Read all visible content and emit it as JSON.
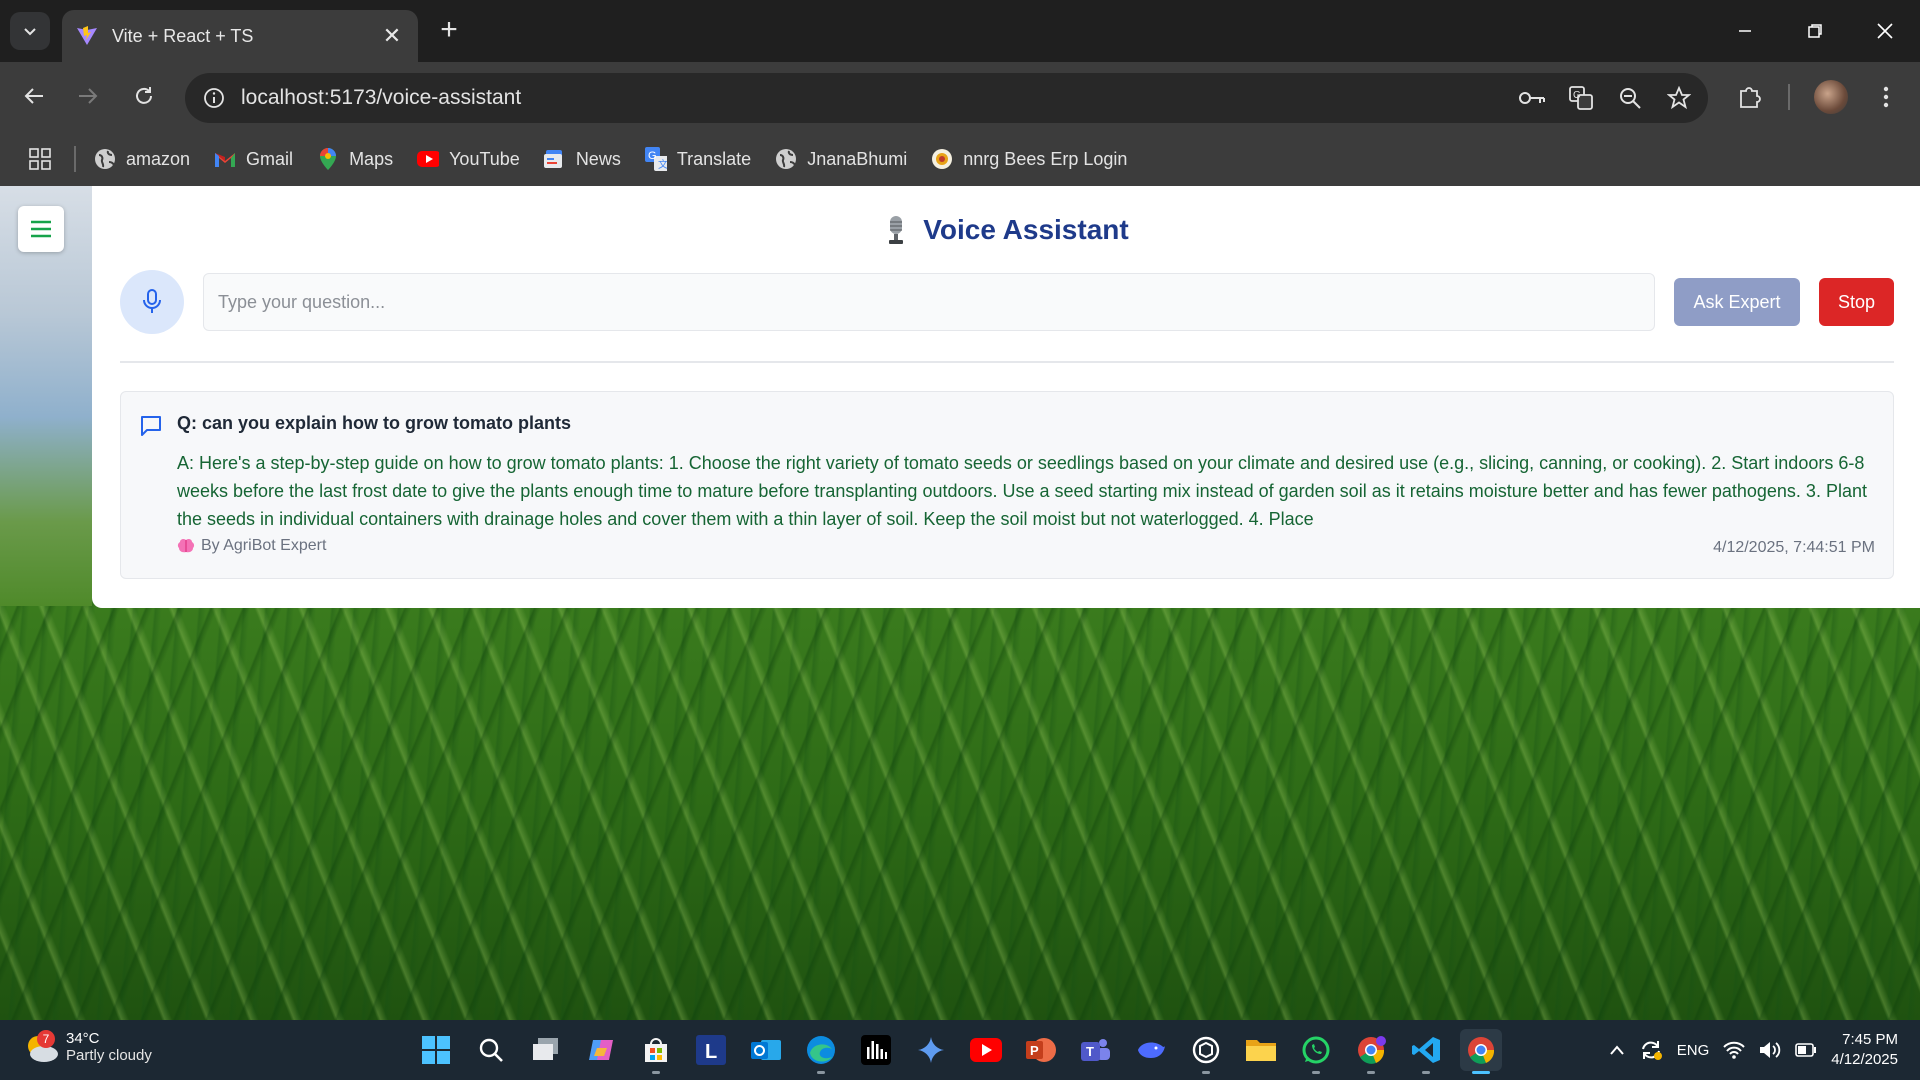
{
  "browser": {
    "tab_title": "Vite + React + TS",
    "url": "localhost:5173/voice-assistant",
    "bookmarks": [
      {
        "label": "amazon",
        "icon": "globe-icon"
      },
      {
        "label": "Gmail",
        "icon": "gmail-icon"
      },
      {
        "label": "Maps",
        "icon": "maps-icon"
      },
      {
        "label": "YouTube",
        "icon": "youtube-icon"
      },
      {
        "label": "News",
        "icon": "news-icon"
      },
      {
        "label": "Translate",
        "icon": "translate-icon"
      },
      {
        "label": "JnanaBhumi",
        "icon": "globe-icon"
      },
      {
        "label": "nnrg Bees Erp Login",
        "icon": "nnrg-icon"
      }
    ]
  },
  "page": {
    "title": "Voice Assistant",
    "input_placeholder": "Type your question...",
    "ask_button": "Ask Expert",
    "stop_button": "Stop",
    "entries": [
      {
        "question": "Q: can you explain how to grow tomato plants",
        "answer": "A: Here's a step-by-step guide on how to grow tomato plants: 1. Choose the right variety of tomato seeds or seedlings based on your climate and desired use (e.g., slicing, canning, or cooking). 2. Start indoors 6-8 weeks before the last frost date to give the plants enough time to mature before transplanting outdoors. Use a seed starting mix instead of garden soil as it retains moisture better and has fewer pathogens. 3. Plant the seeds in individual containers with drainage holes and cover them with a thin layer of soil. Keep the soil moist but not waterlogged. 4. Place",
        "by": "By AgriBot Expert",
        "timestamp": "4/12/2025, 7:44:51 PM"
      }
    ]
  },
  "taskbar": {
    "weather_temp": "34°C",
    "weather_condition": "Partly cloudy",
    "weather_badge": "7",
    "language": "ENG",
    "time": "7:45 PM",
    "date": "4/12/2025"
  },
  "colors": {
    "title_blue": "#1e3a8a",
    "answer_green": "#166534",
    "stop_red": "#dc2626",
    "ask_button": "#8f9dc6"
  }
}
